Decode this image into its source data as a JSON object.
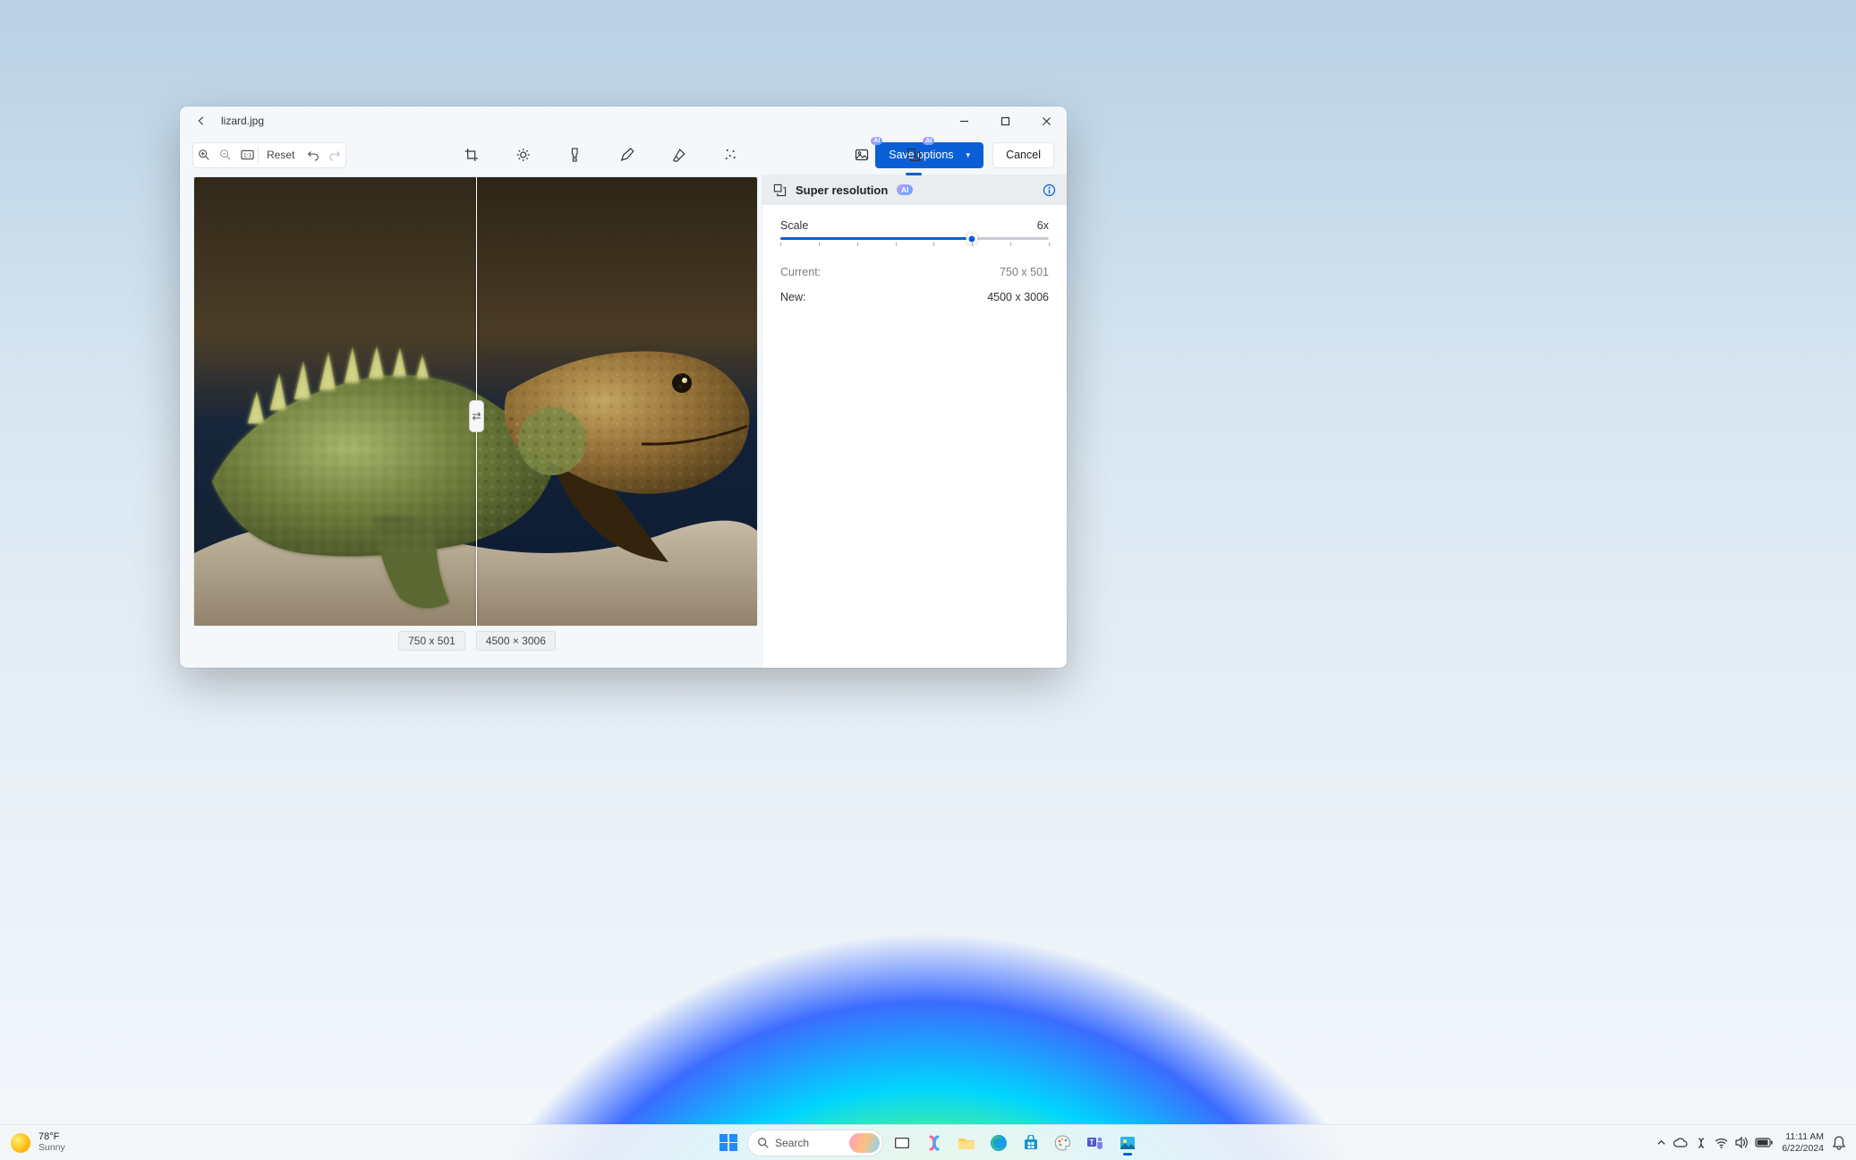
{
  "window": {
    "filename": "lizard.jpg",
    "reset_label": "Reset",
    "save_label": "Save options",
    "cancel_label": "Cancel",
    "dim_left": "750 x 501",
    "dim_right": "4500 × 3006",
    "tools": {
      "zoom_in": "zoom-in",
      "zoom_out": "zoom-out",
      "fit": "fit",
      "undo": "undo",
      "redo": "redo",
      "crop": "crop",
      "adjust": "adjust",
      "filter": "filter",
      "markup": "markup",
      "erase": "erase",
      "retouch": "retouch",
      "ai_bg": "background-ai",
      "ai_sr": "super-resolution-ai"
    },
    "ai_badge": "AI"
  },
  "panel": {
    "title": "Super resolution",
    "badge": "AI",
    "scale_label": "Scale",
    "scale_value": "6x",
    "slider_percent": 71.4,
    "tick_count": 8,
    "current_label": "Current:",
    "current_value": "750 x 501",
    "new_label": "New:",
    "new_value": "4500 x 3006"
  },
  "taskbar": {
    "weather_temp": "78°F",
    "weather_desc": "Sunny",
    "search_label": "Search",
    "apps": [
      "task-view",
      "copilot",
      "explorer",
      "edge",
      "store",
      "paint",
      "teams",
      "photos"
    ],
    "time": "11:11 AM",
    "date": "6/22/2024"
  }
}
